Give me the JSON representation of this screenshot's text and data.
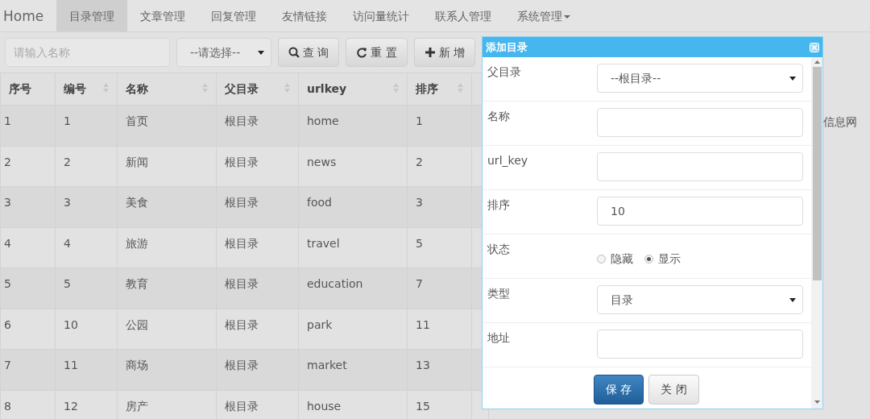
{
  "nav": [
    {
      "label": "Home",
      "selected": false,
      "dropdown": false
    },
    {
      "label": "目录管理",
      "selected": true,
      "dropdown": false
    },
    {
      "label": "文章管理",
      "selected": false,
      "dropdown": false
    },
    {
      "label": "回复管理",
      "selected": false,
      "dropdown": false
    },
    {
      "label": "友情链接",
      "selected": false,
      "dropdown": false
    },
    {
      "label": "访问量统计",
      "selected": false,
      "dropdown": false
    },
    {
      "label": "联系人管理",
      "selected": false,
      "dropdown": false
    },
    {
      "label": "系统管理",
      "selected": false,
      "dropdown": true
    }
  ],
  "toolbar": {
    "search": {
      "placeholder": "请输入名称"
    },
    "filter": {
      "value": "--请选择--"
    },
    "buttons": [
      {
        "label": "查 询",
        "kind": "search"
      },
      {
        "label": "重 置",
        "kind": "refresh"
      },
      {
        "label": "新 增",
        "kind": "plus"
      }
    ]
  },
  "table": {
    "columns": [
      {
        "label": "序号",
        "sortable": false
      },
      {
        "label": "编号",
        "sortable": true
      },
      {
        "label": "名称",
        "sortable": true
      },
      {
        "label": "父目录",
        "sortable": true
      },
      {
        "label": "urlkey",
        "sortable": true
      },
      {
        "label": "排序",
        "sortable": true
      }
    ],
    "rows": [
      {
        "cells": [
          "1",
          "1",
          "首页",
          "根目录",
          "home",
          "1"
        ],
        "column_9": "信息网"
      },
      {
        "cells": [
          "2",
          "2",
          "新闻",
          "根目录",
          "news",
          "2"
        ]
      },
      {
        "cells": [
          "3",
          "3",
          "美食",
          "根目录",
          "food",
          "3"
        ]
      },
      {
        "cells": [
          "4",
          "4",
          "旅游",
          "根目录",
          "travel",
          "5"
        ]
      },
      {
        "cells": [
          "5",
          "5",
          "教育",
          "根目录",
          "education",
          "7"
        ]
      },
      {
        "cells": [
          "6",
          "10",
          "公园",
          "根目录",
          "park",
          "11"
        ]
      },
      {
        "cells": [
          "7",
          "11",
          "商场",
          "根目录",
          "market",
          "13"
        ]
      },
      {
        "cells": [
          "8",
          "12",
          "房产",
          "根目录",
          "house",
          "15"
        ]
      }
    ]
  },
  "dialog": {
    "title": "添加目录",
    "fields": [
      {
        "label": "父目录",
        "kind": "select",
        "value": "--根目录--"
      },
      {
        "label": "名称",
        "kind": "text"
      },
      {
        "label": "url_key",
        "kind": "text"
      },
      {
        "label": "排序",
        "kind": "text",
        "value": "10"
      },
      {
        "label": "状态",
        "kind": "radio",
        "options": [
          {
            "label": "隐藏",
            "selected": false
          },
          {
            "label": "显示",
            "selected": true
          }
        ]
      },
      {
        "label": "类型",
        "kind": "select",
        "value": "目录"
      },
      {
        "label": "地址",
        "kind": "text"
      }
    ],
    "buttons": [
      {
        "label": "保 存",
        "kind": "primary"
      },
      {
        "label": "关 闭",
        "kind": "default"
      }
    ]
  }
}
